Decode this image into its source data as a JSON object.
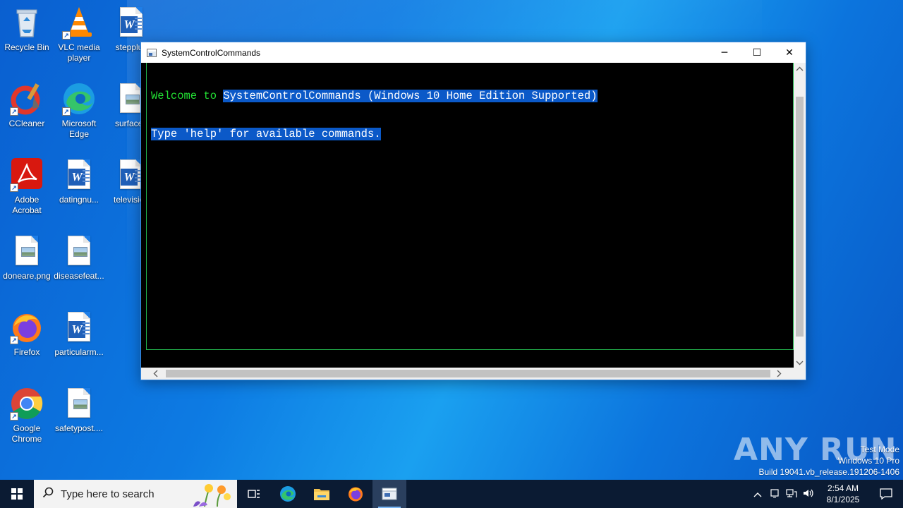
{
  "desktop": {
    "icons": [
      {
        "label": "Recycle Bin"
      },
      {
        "label": "VLC media player"
      },
      {
        "label": "stepplus"
      },
      {
        "label": "CCleaner"
      },
      {
        "label": "Microsoft Edge"
      },
      {
        "label": "surfaceu"
      },
      {
        "label": "Adobe Acrobat"
      },
      {
        "label": "datingnu..."
      },
      {
        "label": "television"
      },
      {
        "label": "doneare.png"
      },
      {
        "label": "diseasefeat..."
      },
      {
        "label": "Firefox"
      },
      {
        "label": "particularm..."
      },
      {
        "label": "Google Chrome"
      },
      {
        "label": "safetypost...."
      }
    ]
  },
  "window": {
    "title": "SystemControlCommands",
    "minimize_glyph": "─",
    "maximize_glyph": "☐",
    "close_glyph": "✕",
    "console": {
      "line1_prefix": "Welcome to ",
      "line1_selected": "SystemControlCommands (Windows 10 Home Edition Supported)",
      "line2_selected": "Type 'help' for available commands."
    }
  },
  "watermark": {
    "brand": "ANY RUN",
    "line1": "Test Mode",
    "line2": "Windows 10 Pro",
    "line3": "Build 19041.vb_release.191206-1406"
  },
  "taskbar": {
    "search_placeholder": "Type here to search",
    "clock_time": "2:54 AM",
    "clock_date": "8/1/2025"
  },
  "colors": {
    "console_green": "#22dd33",
    "selection_blue": "#0b59c8",
    "taskbar_bg": "#0b1b33"
  }
}
